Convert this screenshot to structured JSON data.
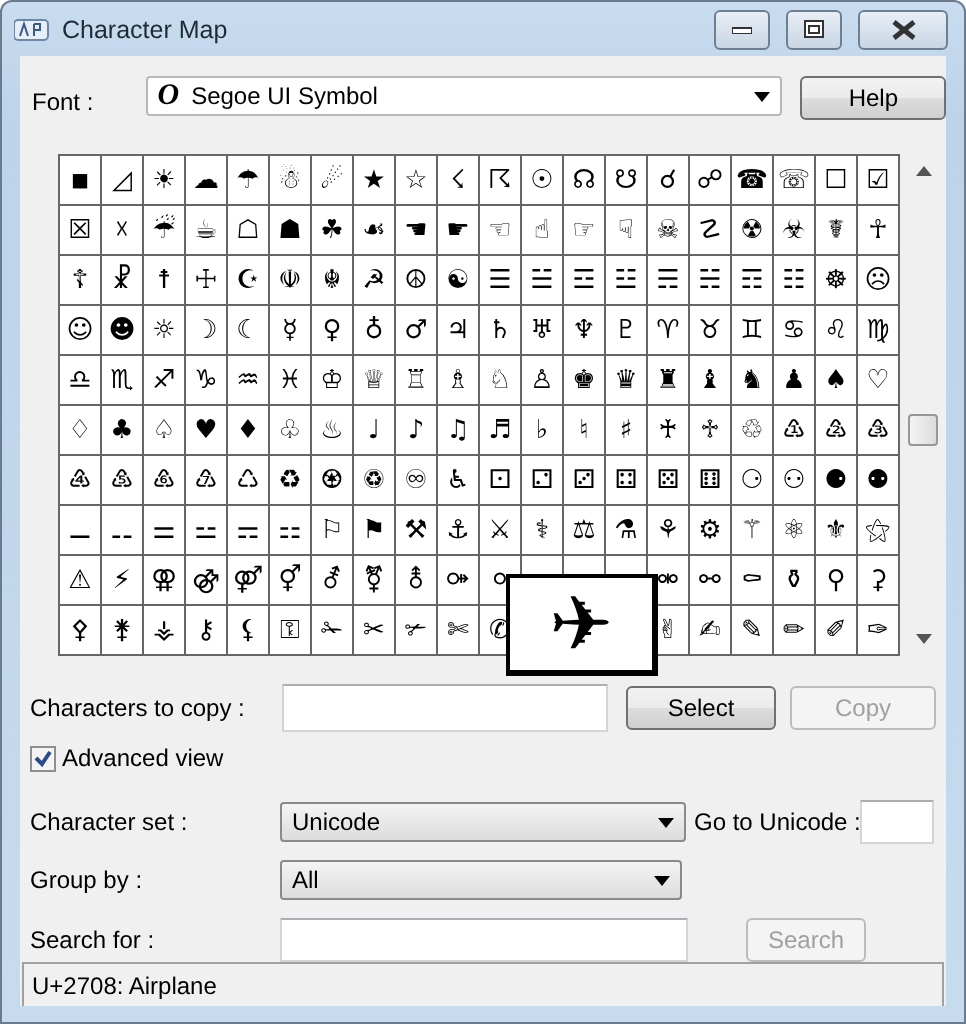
{
  "window": {
    "title": "Character Map"
  },
  "font": {
    "label": "Font :",
    "value": "Segoe UI Symbol",
    "icon": "O"
  },
  "help_button": "Help",
  "grid": [
    [
      "◾",
      "◿",
      "☀",
      "☁",
      "☂",
      "☃",
      "☄",
      "★",
      "☆",
      "☇",
      "☈",
      "☉",
      "☊",
      "☋",
      "☌",
      "☍",
      "☎",
      "☏",
      "☐",
      "☑"
    ],
    [
      "☒",
      "☓",
      "☔",
      "☕",
      "☖",
      "☗",
      "☘",
      "☙",
      "☚",
      "☛",
      "☜",
      "☝",
      "☞",
      "☟",
      "☠",
      "☡",
      "☢",
      "☣",
      "☤",
      "☥"
    ],
    [
      "☦",
      "☧",
      "☨",
      "☩",
      "☪",
      "☫",
      "☬",
      "☭",
      "☮",
      "☯",
      "☰",
      "☱",
      "☲",
      "☳",
      "☴",
      "☵",
      "☶",
      "☷",
      "☸",
      "☹"
    ],
    [
      "☺",
      "☻",
      "☼",
      "☽",
      "☾",
      "☿",
      "♀",
      "♁",
      "♂",
      "♃",
      "♄",
      "♅",
      "♆",
      "♇",
      "♈",
      "♉",
      "♊",
      "♋",
      "♌",
      "♍"
    ],
    [
      "♎",
      "♏",
      "♐",
      "♑",
      "♒",
      "♓",
      "♔",
      "♕",
      "♖",
      "♗",
      "♘",
      "♙",
      "♚",
      "♛",
      "♜",
      "♝",
      "♞",
      "♟",
      "♠",
      "♡"
    ],
    [
      "♢",
      "♣",
      "♤",
      "♥",
      "♦",
      "♧",
      "♨",
      "♩",
      "♪",
      "♫",
      "♬",
      "♭",
      "♮",
      "♯",
      "♰",
      "♱",
      "♲",
      "♳",
      "♴",
      "♵"
    ],
    [
      "♶",
      "♷",
      "♸",
      "♹",
      "♺",
      "♻",
      "♼",
      "♽",
      "♾",
      "♿",
      "⚀",
      "⚁",
      "⚂",
      "⚃",
      "⚄",
      "⚅",
      "⚆",
      "⚇",
      "⚈",
      "⚉"
    ],
    [
      "⚊",
      "⚋",
      "⚌",
      "⚍",
      "⚎",
      "⚏",
      "⚐",
      "⚑",
      "⚒",
      "⚓",
      "⚔",
      "⚕",
      "⚖",
      "⚗",
      "⚘",
      "⚙",
      "⚚",
      "⚛",
      "⚜",
      "⚝"
    ],
    {
      "cells": [
        "⚠",
        "⚡",
        "⚢",
        "⚣",
        "⚤",
        "⚥",
        "⚦",
        "⚧",
        "⚨",
        "⚩",
        "⚪"
      ],
      "cells_after": [
        "⚮",
        "⚯",
        "⚰",
        "⚱",
        "⚲",
        "⚳"
      ]
    },
    {
      "cells": [
        "⚴",
        "⚵",
        "⚶",
        "⚷",
        "⚸",
        "⚿",
        "✁",
        "✂",
        "✃",
        "✄",
        "✆"
      ],
      "cells_after": [
        "✌",
        "✍",
        "✎",
        "✏",
        "✐",
        "✑"
      ]
    }
  ],
  "popup": "✈",
  "copy": {
    "label": "Characters to copy :",
    "select_button": "Select",
    "copy_button": {
      "label": "Copy",
      "disabled": true
    }
  },
  "advanced_view": {
    "label": "Advanced view",
    "checked": true
  },
  "character_set": {
    "label": "Character set :",
    "value": "Unicode"
  },
  "go_to_unicode": {
    "label": "Go to Unicode :"
  },
  "group_by": {
    "label": "Group by :",
    "value": "All"
  },
  "search": {
    "label": "Search for :",
    "button": {
      "label": "Search",
      "disabled": true
    }
  },
  "status_bar": "U+2708: Airplane"
}
